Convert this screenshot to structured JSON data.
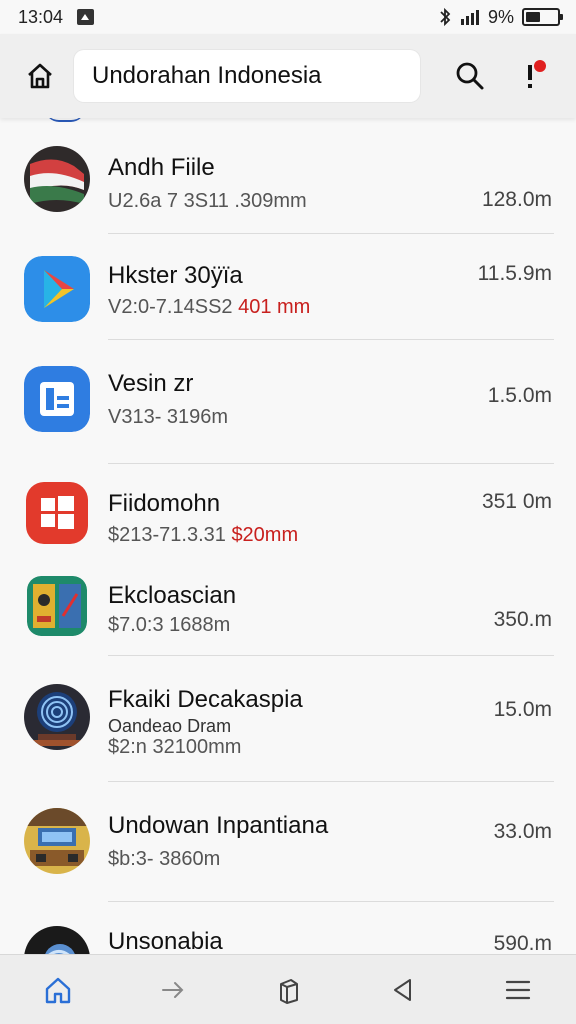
{
  "status_bar": {
    "time": "13:04",
    "battery_text": "9%",
    "battery_level_percent": 45,
    "icons": [
      "notification-icon",
      "bluetooth-icon",
      "signal-icon",
      "battery-icon"
    ]
  },
  "header": {
    "search_value": "Undorahan Indonesia",
    "icons": [
      "home-icon",
      "search-icon",
      "alert-icon"
    ],
    "alert_color": "#e02020"
  },
  "apps": [
    {
      "name": "Andh Fiile",
      "version_plain": "U2.6a 7 3S11 ",
      "version_highlight": "",
      "version_tail": ".309mm",
      "sub": "",
      "size": "128.0m",
      "icon": "flag-icon"
    },
    {
      "name": "Hkster 30ÿïa",
      "version_plain": "V2:0-7.14SS2 ",
      "version_highlight": "401 mm",
      "version_tail": "",
      "sub": "",
      "size": "11.5.9m",
      "icon": "play-icon"
    },
    {
      "name": "Vesin zr",
      "version_plain": "V313- 3196m",
      "version_highlight": "",
      "version_tail": "",
      "sub": "",
      "size": "1.5.0m",
      "icon": "document-icon"
    },
    {
      "name": "Fiidomohn",
      "version_plain": "$213-71.3.31 ",
      "version_highlight": "$20mm",
      "version_tail": "",
      "sub": "",
      "size": "351 0m",
      "icon": "windows-icon"
    },
    {
      "name": "Ekcloascian",
      "version_plain": "$7.0:3 1688m",
      "version_highlight": "",
      "version_tail": "",
      "sub": "",
      "size": "350.m",
      "icon": "game-icon"
    },
    {
      "name": "Fkaiki Decakaspia",
      "version_plain": "$2:n 32100mm",
      "version_highlight": "",
      "version_tail": "",
      "sub": "Oandeao Dram",
      "size": "15.0m",
      "icon": "fingerprint-icon"
    },
    {
      "name": "Undowan Inpantiana",
      "version_plain": "$b:3- 3860m",
      "version_highlight": "",
      "version_tail": "",
      "sub": "",
      "size": "33.0m",
      "icon": "shop-icon"
    },
    {
      "name": "Unsonabia",
      "version_plain": "",
      "version_highlight": "",
      "version_tail": "",
      "sub": "",
      "size": "590.m",
      "icon": "globe-icon"
    }
  ],
  "bottom_nav": {
    "items": [
      "home-nav-icon",
      "forward-icon",
      "files-icon",
      "back-icon",
      "menu-icon"
    ],
    "active_color": "#2a6fd6"
  }
}
